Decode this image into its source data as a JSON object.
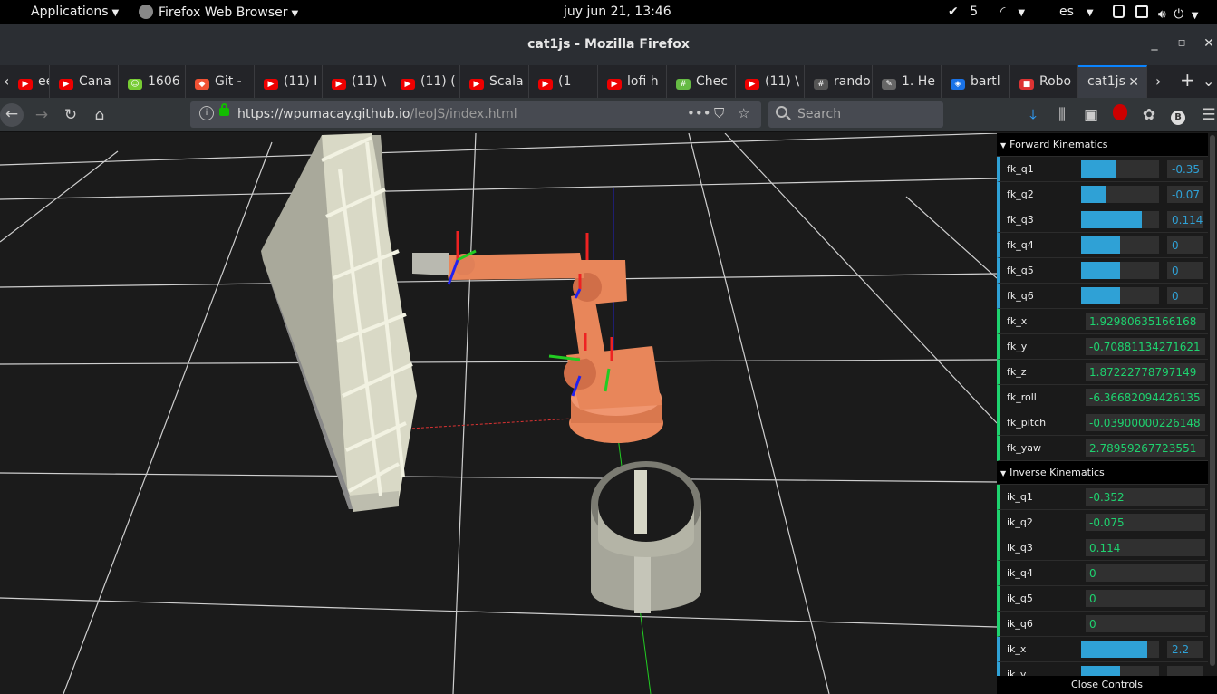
{
  "system_bar": {
    "applications": "Applications",
    "app_name": "Firefox Web Browser",
    "clock": "juy jun 21, 13:46",
    "updates_count": "5",
    "language": "es"
  },
  "window": {
    "title": "cat1js - Mozilla Firefox"
  },
  "tabs": [
    {
      "label": "eep",
      "icon": "youtube"
    },
    {
      "label": "Cana",
      "icon": "youtube"
    },
    {
      "label": "1606",
      "icon": "smiley"
    },
    {
      "label": "Git -",
      "icon": "git"
    },
    {
      "label": "(11) I",
      "icon": "youtube"
    },
    {
      "label": "(11) \\",
      "icon": "youtube"
    },
    {
      "label": "(11) (",
      "icon": "youtube"
    },
    {
      "label": "Scala",
      "icon": "youtube"
    },
    {
      "label": "(1",
      "icon": "youtube"
    },
    {
      "label": "lofi h",
      "icon": "youtube"
    },
    {
      "label": "Chec",
      "icon": "slack"
    },
    {
      "label": "(11) \\",
      "icon": "youtube"
    },
    {
      "label": "rando",
      "icon": "hash"
    },
    {
      "label": "1. He",
      "icon": "feather"
    },
    {
      "label": "bartl",
      "icon": "shield"
    },
    {
      "label": "Robo",
      "icon": "robot"
    },
    {
      "label": "cat1js",
      "icon": "none",
      "active": true
    }
  ],
  "navbar": {
    "url_host": "https://wpumacay.github.io",
    "url_path": "/leoJS/index.html",
    "search_placeholder": "Search"
  },
  "gui": {
    "fk_folder": "Forward Kinematics",
    "ik_folder": "Inverse Kinematics",
    "close_label": "Close Controls",
    "fk_sliders": [
      {
        "name": "fk_q1",
        "value": "-0.35",
        "level": 0.44
      },
      {
        "name": "fk_q2",
        "value": "-0.07",
        "level": 0.31
      },
      {
        "name": "fk_q3",
        "value": "0.114",
        "level": 0.78
      },
      {
        "name": "fk_q4",
        "value": "0",
        "level": 0.5
      },
      {
        "name": "fk_q5",
        "value": "0",
        "level": 0.5
      },
      {
        "name": "fk_q6",
        "value": "0",
        "level": 0.5
      }
    ],
    "fk_values": [
      {
        "name": "fk_x",
        "value": "1.92980635166168"
      },
      {
        "name": "fk_y",
        "value": "-0.70881134271621"
      },
      {
        "name": "fk_z",
        "value": "1.87222778797149"
      },
      {
        "name": "fk_roll",
        "value": "-6.36682094426135"
      },
      {
        "name": "fk_pitch",
        "value": "-0.03900000226148"
      },
      {
        "name": "fk_yaw",
        "value": "2.78959267723551"
      }
    ],
    "ik_values": [
      {
        "name": "ik_q1",
        "value": "-0.352"
      },
      {
        "name": "ik_q2",
        "value": "-0.075"
      },
      {
        "name": "ik_q3",
        "value": "0.114"
      },
      {
        "name": "ik_q4",
        "value": "0"
      },
      {
        "name": "ik_q5",
        "value": "0"
      },
      {
        "name": "ik_q6",
        "value": "0"
      }
    ],
    "ik_sliders": [
      {
        "name": "ik_x",
        "value": "2.2",
        "level": 0.85
      },
      {
        "name": "ik_y",
        "value": "",
        "level": 0.5
      }
    ]
  },
  "colors": {
    "robot": "#e8865a",
    "slider_blue": "#2fa1d6",
    "value_green": "#1ed36f",
    "tab_accent": "#0a84ff"
  }
}
